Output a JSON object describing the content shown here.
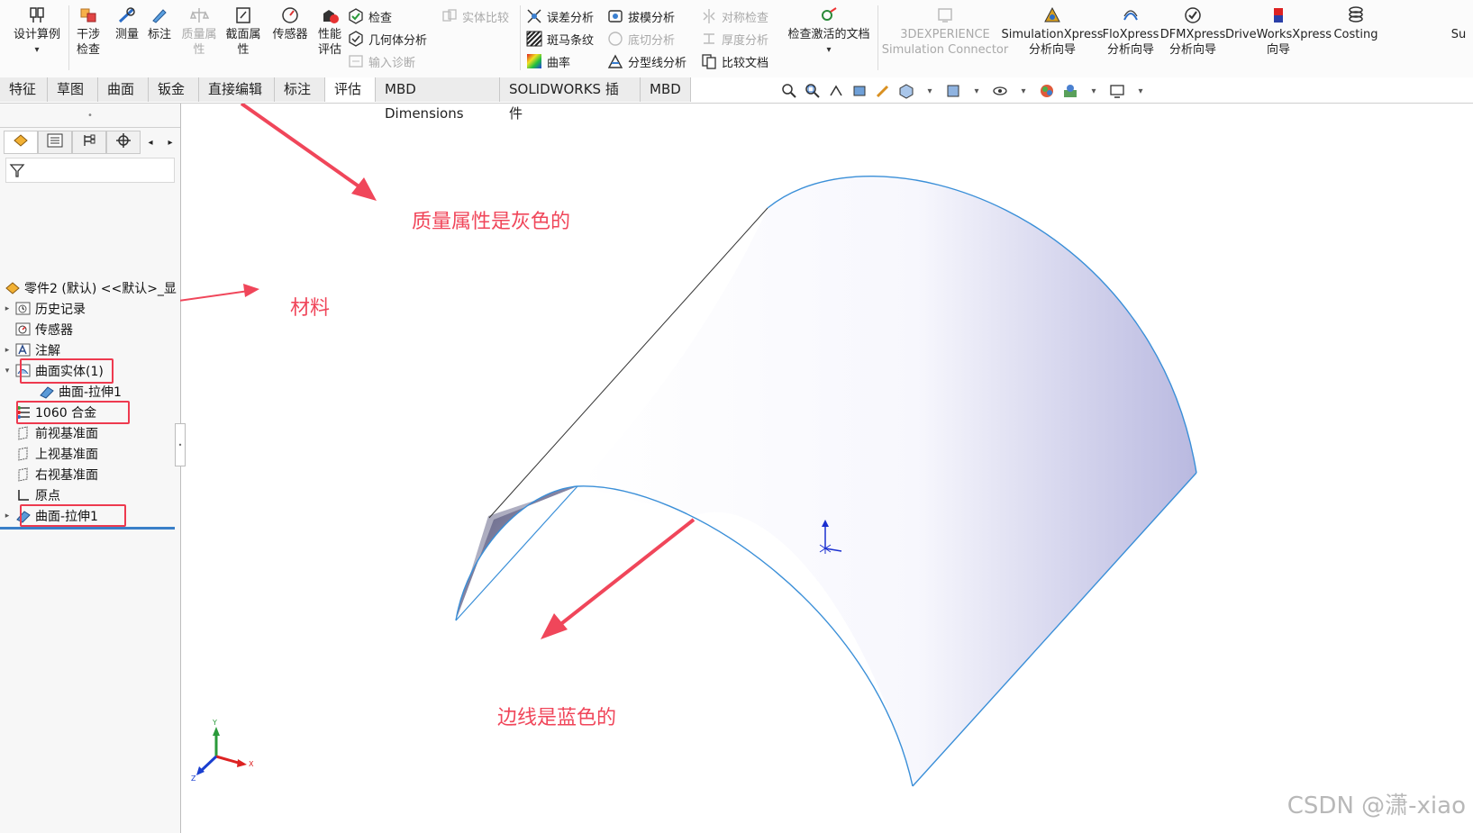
{
  "ribbon": {
    "large_buttons": [
      {
        "label": "设计算例",
        "icon": "design-study-icon",
        "enabled": true
      },
      {
        "label": "干涉检查",
        "icon": "interference-icon",
        "enabled": true
      },
      {
        "label": "测量",
        "icon": "measure-icon",
        "enabled": true
      },
      {
        "label": "标注",
        "icon": "markup-icon",
        "enabled": true
      },
      {
        "label": "质量属性",
        "icon": "mass-properties-icon",
        "enabled": false
      },
      {
        "label": "截面属性",
        "icon": "section-properties-icon",
        "enabled": true
      },
      {
        "label": "传感器",
        "icon": "sensor-icon",
        "enabled": true
      },
      {
        "label": "性能评估",
        "icon": "performance-eval-icon",
        "enabled": true
      }
    ],
    "col_check": [
      {
        "label": "检查",
        "enabled": true
      },
      {
        "label": "几何体分析",
        "enabled": true
      },
      {
        "label": "输入诊断",
        "enabled": false
      }
    ],
    "compare_label": "实体比较",
    "col_analysis1": [
      {
        "label": "误差分析",
        "enabled": true
      },
      {
        "label": "斑马条纹",
        "enabled": true
      },
      {
        "label": "曲率",
        "enabled": true
      }
    ],
    "col_analysis2": [
      {
        "label": "拔模分析",
        "enabled": true
      },
      {
        "label": "底切分析",
        "enabled": false
      },
      {
        "label": "分型线分析",
        "enabled": true
      }
    ],
    "col_analysis3": [
      {
        "label": "对称检查",
        "enabled": false
      },
      {
        "label": "厚度分析",
        "enabled": false
      },
      {
        "label": "比较文档",
        "enabled": true
      }
    ],
    "check_active_doc": "检查激活的文档",
    "connector": {
      "line1": "3DEXPERIENCE",
      "line2": "Simulation Connector"
    },
    "xpress": [
      {
        "line1": "SimulationXpress",
        "line2": "分析向导"
      },
      {
        "line1": "FloXpress",
        "line2": "分析向导"
      },
      {
        "line1": "DFMXpress",
        "line2": "分析向导"
      },
      {
        "line1": "DriveWorksXpress",
        "line2": "向导"
      },
      {
        "line1": "Costing",
        "line2": ""
      },
      {
        "line1": "Su",
        "line2": ""
      }
    ]
  },
  "tabs": [
    "特征",
    "草图",
    "曲面",
    "钣金",
    "直接编辑",
    "标注",
    "评估",
    "MBD Dimensions",
    "SOLIDWORKS 插件",
    "MBD"
  ],
  "active_tab": "评估",
  "tree": {
    "part": "零件2 (默认) <<默认>_显",
    "items": [
      {
        "label": "历史记录",
        "expander": "▸"
      },
      {
        "label": "传感器",
        "expander": ""
      },
      {
        "label": "注解",
        "expander": "▸"
      },
      {
        "label": "曲面实体(1)",
        "expander": "▾"
      },
      {
        "label": "曲面-拉伸1",
        "expander": ""
      },
      {
        "label": "1060 合金",
        "expander": ""
      },
      {
        "label": "前视基准面",
        "expander": ""
      },
      {
        "label": "上视基准面",
        "expander": ""
      },
      {
        "label": "右视基准面",
        "expander": ""
      },
      {
        "label": "原点",
        "expander": ""
      },
      {
        "label": "曲面-拉伸1",
        "expander": "▸"
      }
    ]
  },
  "annotations": {
    "mass_gray": "质量属性是灰色的",
    "material": "材料",
    "edges_blue": "边线是蓝色的"
  },
  "triad": {
    "x": "X",
    "y": "Y",
    "z": "Z"
  },
  "watermark": "CSDN @潇-xiao",
  "colors": {
    "annotation_red": "#f0465a",
    "edge_blue": "#3a8fd8",
    "surface_light": "#f4f4fc",
    "surface_dark": "#6e6e92"
  }
}
